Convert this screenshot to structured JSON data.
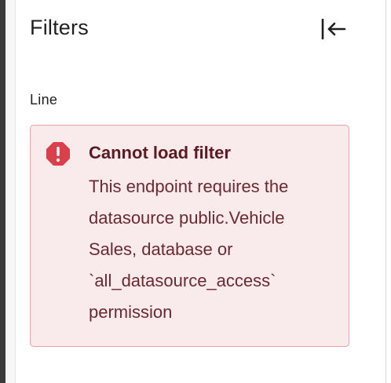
{
  "panel": {
    "title": "Filters",
    "collapse_icon": "collapse-left-icon"
  },
  "filter": {
    "label": "Line",
    "error": {
      "icon": "error-octagon-icon",
      "title": "Cannot load filter",
      "message": "This endpoint requires the\ndatasource public.Vehicle\nSales, database or\n`all_datasource_access`\npermission"
    }
  },
  "colors": {
    "alert_background": "#f9eaec",
    "alert_border": "#e9a0a8",
    "alert_icon": "#d9404c",
    "alert_text": "#6a2a31"
  }
}
